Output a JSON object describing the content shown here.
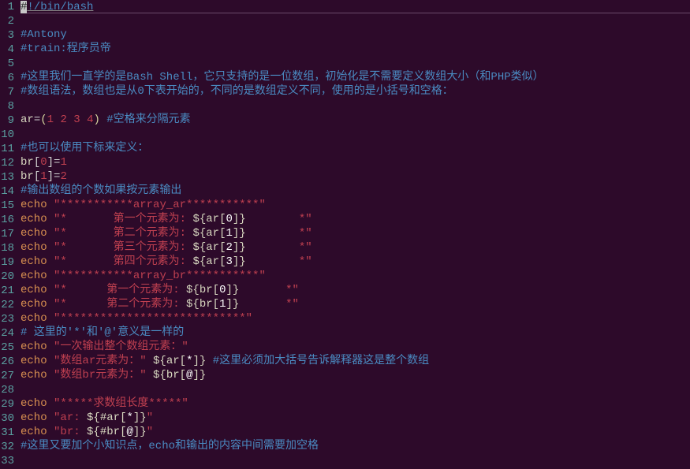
{
  "lines": [
    {
      "n": 1,
      "tokens": [
        {
          "t": "#",
          "cls": "c-shebang-bg"
        },
        {
          "t": "!/bin/bash",
          "cls": "c-comment c-underscore"
        }
      ],
      "cursor": true
    },
    {
      "n": 2,
      "tokens": []
    },
    {
      "n": 3,
      "tokens": [
        {
          "t": "#Antony",
          "cls": "c-comment"
        }
      ]
    },
    {
      "n": 4,
      "tokens": [
        {
          "t": "#train:程序员帝",
          "cls": "c-comment"
        }
      ]
    },
    {
      "n": 5,
      "tokens": []
    },
    {
      "n": 6,
      "tokens": [
        {
          "t": "#这里我们一直学的是Bash Shell，它只支持的是一位数组，初始化是不需要定义数组大小（和PHP类似）",
          "cls": "c-comment"
        }
      ]
    },
    {
      "n": 7,
      "tokens": [
        {
          "t": "#数组语法，数组也是从0下表开始的，不同的是数组定义不同，使用的是小括号和空格：",
          "cls": "c-comment"
        }
      ]
    },
    {
      "n": 8,
      "tokens": []
    },
    {
      "n": 9,
      "tokens": [
        {
          "t": "ar",
          "cls": "c-var"
        },
        {
          "t": "=",
          "cls": "c-op"
        },
        {
          "t": "(",
          "cls": "c-paren"
        },
        {
          "t": "1",
          "cls": "c-num"
        },
        {
          "t": " ",
          "cls": ""
        },
        {
          "t": "2",
          "cls": "c-num"
        },
        {
          "t": " ",
          "cls": ""
        },
        {
          "t": "3",
          "cls": "c-num"
        },
        {
          "t": " ",
          "cls": ""
        },
        {
          "t": "4",
          "cls": "c-num"
        },
        {
          "t": ")",
          "cls": "c-paren"
        },
        {
          "t": " ",
          "cls": ""
        },
        {
          "t": "#空格来分隔元素",
          "cls": "c-comment"
        }
      ]
    },
    {
      "n": 10,
      "tokens": []
    },
    {
      "n": 11,
      "tokens": [
        {
          "t": "#也可以使用下标来定义：",
          "cls": "c-comment"
        }
      ]
    },
    {
      "n": 12,
      "tokens": [
        {
          "t": "br",
          "cls": "c-var"
        },
        {
          "t": "[",
          "cls": "c-bracket"
        },
        {
          "t": "0",
          "cls": "c-num"
        },
        {
          "t": "]",
          "cls": "c-bracket"
        },
        {
          "t": "=",
          "cls": "c-op"
        },
        {
          "t": "1",
          "cls": "c-num"
        }
      ]
    },
    {
      "n": 13,
      "tokens": [
        {
          "t": "br",
          "cls": "c-var"
        },
        {
          "t": "[",
          "cls": "c-bracket"
        },
        {
          "t": "1",
          "cls": "c-num"
        },
        {
          "t": "]",
          "cls": "c-bracket"
        },
        {
          "t": "=",
          "cls": "c-op"
        },
        {
          "t": "2",
          "cls": "c-num"
        }
      ]
    },
    {
      "n": 14,
      "tokens": [
        {
          "t": "#输出数组的个数如果按元素输出",
          "cls": "c-comment"
        }
      ]
    },
    {
      "n": 15,
      "tokens": [
        {
          "t": "echo",
          "cls": "c-cmd"
        },
        {
          "t": " ",
          "cls": ""
        },
        {
          "t": "\"***********array_ar***********\"",
          "cls": "c-str"
        }
      ]
    },
    {
      "n": 16,
      "tokens": [
        {
          "t": "echo",
          "cls": "c-cmd"
        },
        {
          "t": " ",
          "cls": ""
        },
        {
          "t": "\"*       第一个元素为: ",
          "cls": "c-str"
        },
        {
          "t": "${",
          "cls": "c-special"
        },
        {
          "t": "ar",
          "cls": "c-special"
        },
        {
          "t": "[",
          "cls": "c-special"
        },
        {
          "t": "0",
          "cls": "c-white"
        },
        {
          "t": "]}",
          "cls": "c-special"
        },
        {
          "t": "        *\"",
          "cls": "c-str"
        }
      ]
    },
    {
      "n": 17,
      "tokens": [
        {
          "t": "echo",
          "cls": "c-cmd"
        },
        {
          "t": " ",
          "cls": ""
        },
        {
          "t": "\"*       第二个元素为: ",
          "cls": "c-str"
        },
        {
          "t": "${",
          "cls": "c-special"
        },
        {
          "t": "ar",
          "cls": "c-special"
        },
        {
          "t": "[",
          "cls": "c-special"
        },
        {
          "t": "1",
          "cls": "c-white"
        },
        {
          "t": "]}",
          "cls": "c-special"
        },
        {
          "t": "        *\"",
          "cls": "c-str"
        }
      ]
    },
    {
      "n": 18,
      "tokens": [
        {
          "t": "echo",
          "cls": "c-cmd"
        },
        {
          "t": " ",
          "cls": ""
        },
        {
          "t": "\"*       第三个元素为: ",
          "cls": "c-str"
        },
        {
          "t": "${",
          "cls": "c-special"
        },
        {
          "t": "ar",
          "cls": "c-special"
        },
        {
          "t": "[",
          "cls": "c-special"
        },
        {
          "t": "2",
          "cls": "c-white"
        },
        {
          "t": "]}",
          "cls": "c-special"
        },
        {
          "t": "        *\"",
          "cls": "c-str"
        }
      ]
    },
    {
      "n": 19,
      "tokens": [
        {
          "t": "echo",
          "cls": "c-cmd"
        },
        {
          "t": " ",
          "cls": ""
        },
        {
          "t": "\"*       第四个元素为: ",
          "cls": "c-str"
        },
        {
          "t": "${",
          "cls": "c-special"
        },
        {
          "t": "ar",
          "cls": "c-special"
        },
        {
          "t": "[",
          "cls": "c-special"
        },
        {
          "t": "3",
          "cls": "c-white"
        },
        {
          "t": "]}",
          "cls": "c-special"
        },
        {
          "t": "        *\"",
          "cls": "c-str"
        }
      ]
    },
    {
      "n": 20,
      "tokens": [
        {
          "t": "echo",
          "cls": "c-cmd"
        },
        {
          "t": " ",
          "cls": ""
        },
        {
          "t": "\"***********array_br***********\"",
          "cls": "c-str"
        }
      ]
    },
    {
      "n": 21,
      "tokens": [
        {
          "t": "echo",
          "cls": "c-cmd"
        },
        {
          "t": " ",
          "cls": ""
        },
        {
          "t": "\"*      第一个元素为: ",
          "cls": "c-str"
        },
        {
          "t": "${",
          "cls": "c-special"
        },
        {
          "t": "br",
          "cls": "c-special"
        },
        {
          "t": "[",
          "cls": "c-special"
        },
        {
          "t": "0",
          "cls": "c-white"
        },
        {
          "t": "]}",
          "cls": "c-special"
        },
        {
          "t": "       *\"",
          "cls": "c-str"
        }
      ]
    },
    {
      "n": 22,
      "tokens": [
        {
          "t": "echo",
          "cls": "c-cmd"
        },
        {
          "t": " ",
          "cls": ""
        },
        {
          "t": "\"*      第二个元素为: ",
          "cls": "c-str"
        },
        {
          "t": "${",
          "cls": "c-special"
        },
        {
          "t": "br",
          "cls": "c-special"
        },
        {
          "t": "[",
          "cls": "c-special"
        },
        {
          "t": "1",
          "cls": "c-white"
        },
        {
          "t": "]}",
          "cls": "c-special"
        },
        {
          "t": "       *\"",
          "cls": "c-str"
        }
      ]
    },
    {
      "n": 23,
      "tokens": [
        {
          "t": "echo",
          "cls": "c-cmd"
        },
        {
          "t": " ",
          "cls": ""
        },
        {
          "t": "\"****************************\"",
          "cls": "c-str"
        }
      ]
    },
    {
      "n": 24,
      "tokens": [
        {
          "t": "# 这里的'*'和'@'意义是一样的",
          "cls": "c-comment"
        }
      ]
    },
    {
      "n": 25,
      "tokens": [
        {
          "t": "echo",
          "cls": "c-cmd"
        },
        {
          "t": " ",
          "cls": ""
        },
        {
          "t": "\"一次输出整个数组元素：\"",
          "cls": "c-str"
        }
      ]
    },
    {
      "n": 26,
      "tokens": [
        {
          "t": "echo",
          "cls": "c-cmd"
        },
        {
          "t": " ",
          "cls": ""
        },
        {
          "t": "\"数组ar元素为：\"",
          "cls": "c-str"
        },
        {
          "t": " ",
          "cls": ""
        },
        {
          "t": "${",
          "cls": "c-special"
        },
        {
          "t": "ar",
          "cls": "c-special"
        },
        {
          "t": "[",
          "cls": "c-special"
        },
        {
          "t": "*",
          "cls": "c-white"
        },
        {
          "t": "]}",
          "cls": "c-special"
        },
        {
          "t": " ",
          "cls": ""
        },
        {
          "t": "#这里必须加大括号告诉解释器这是整个数组",
          "cls": "c-comment"
        }
      ]
    },
    {
      "n": 27,
      "tokens": [
        {
          "t": "echo",
          "cls": "c-cmd"
        },
        {
          "t": " ",
          "cls": ""
        },
        {
          "t": "\"数组br元素为：\"",
          "cls": "c-str"
        },
        {
          "t": " ",
          "cls": ""
        },
        {
          "t": "${",
          "cls": "c-special"
        },
        {
          "t": "br",
          "cls": "c-special"
        },
        {
          "t": "[",
          "cls": "c-special"
        },
        {
          "t": "@",
          "cls": "c-white"
        },
        {
          "t": "]}",
          "cls": "c-special"
        }
      ]
    },
    {
      "n": 28,
      "tokens": []
    },
    {
      "n": 29,
      "tokens": [
        {
          "t": "echo",
          "cls": "c-cmd"
        },
        {
          "t": " ",
          "cls": ""
        },
        {
          "t": "\"*****求数组长度*****\"",
          "cls": "c-str"
        }
      ]
    },
    {
      "n": 30,
      "tokens": [
        {
          "t": "echo",
          "cls": "c-cmd"
        },
        {
          "t": " ",
          "cls": ""
        },
        {
          "t": "\"ar: ",
          "cls": "c-str"
        },
        {
          "t": "${#",
          "cls": "c-special"
        },
        {
          "t": "ar",
          "cls": "c-special"
        },
        {
          "t": "[",
          "cls": "c-special"
        },
        {
          "t": "*",
          "cls": "c-white"
        },
        {
          "t": "]}",
          "cls": "c-special"
        },
        {
          "t": "\"",
          "cls": "c-str"
        }
      ]
    },
    {
      "n": 31,
      "tokens": [
        {
          "t": "echo",
          "cls": "c-cmd"
        },
        {
          "t": " ",
          "cls": ""
        },
        {
          "t": "\"br: ",
          "cls": "c-str"
        },
        {
          "t": "${#",
          "cls": "c-special"
        },
        {
          "t": "br",
          "cls": "c-special"
        },
        {
          "t": "[",
          "cls": "c-special"
        },
        {
          "t": "@",
          "cls": "c-white"
        },
        {
          "t": "]}",
          "cls": "c-special"
        },
        {
          "t": "\"",
          "cls": "c-str"
        }
      ]
    },
    {
      "n": 32,
      "tokens": [
        {
          "t": "#这里又要加个小知识点，echo和输出的内容中间需要加空格",
          "cls": "c-comment"
        }
      ]
    },
    {
      "n": 33,
      "tokens": []
    }
  ]
}
